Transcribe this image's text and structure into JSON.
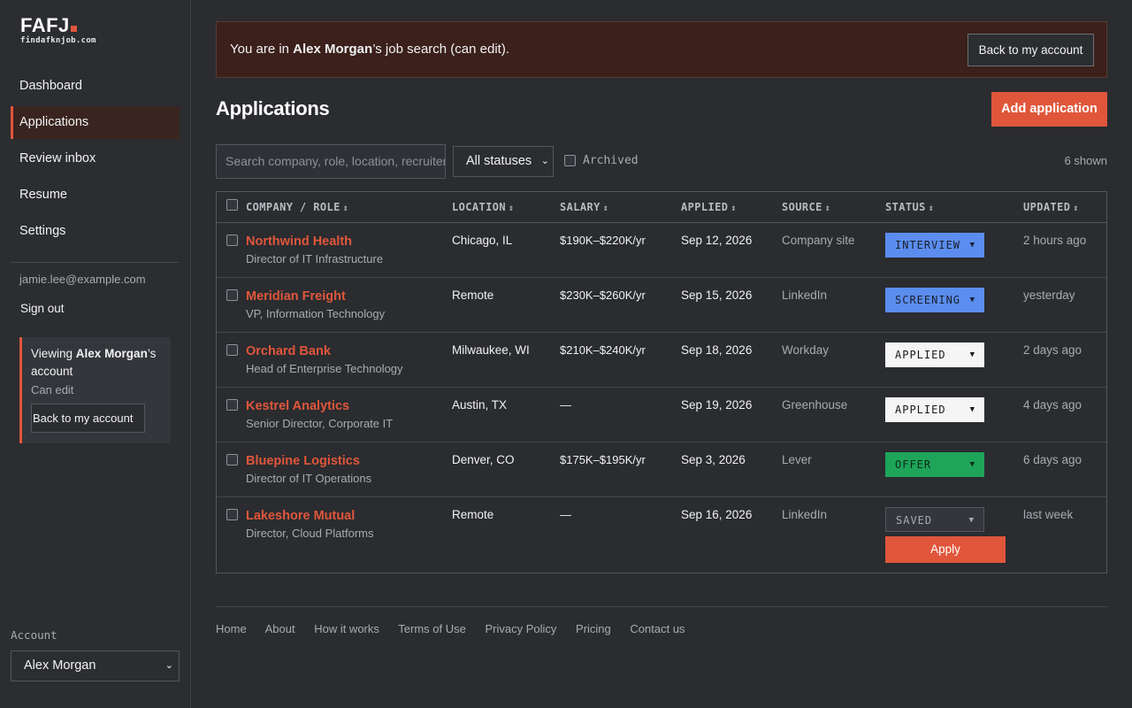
{
  "brand": {
    "name": "FAFJ",
    "domain": "findafknjob.com",
    "accent": "#e0563b"
  },
  "sidebar": {
    "items": [
      {
        "label": "Dashboard"
      },
      {
        "label": "Applications"
      },
      {
        "label": "Review inbox"
      },
      {
        "label": "Resume"
      },
      {
        "label": "Settings"
      }
    ],
    "email": "jamie.lee@example.com",
    "sign_out": "Sign out",
    "viewing": {
      "prefix": "Viewing ",
      "name": "Alex Morgan",
      "suffix": "’s account",
      "permission": "Can edit",
      "back_label": "Back to my account"
    },
    "account_label": "Account",
    "account_value": "Alex Morgan"
  },
  "banner": {
    "prefix": "You are in ",
    "name": "Alex Morgan",
    "suffix": "’s job search (can edit).",
    "button": "Back to my account"
  },
  "page": {
    "title": "Applications",
    "add_button": "Add application"
  },
  "filters": {
    "search_placeholder": "Search company, role, location, recruiter",
    "status_value": "All statuses",
    "archived_label": "Archived",
    "shown": "6 shown"
  },
  "table": {
    "columns": [
      "COMPANY / ROLE",
      "LOCATION",
      "SALARY",
      "APPLIED",
      "SOURCE",
      "STATUS",
      "UPDATED"
    ],
    "rows": [
      {
        "company": "Northwind Health",
        "role": "Director of IT Infrastructure",
        "location": "Chicago, IL",
        "salary": "$190K–$220K/yr",
        "applied": "Sep 12, 2026",
        "source": "Company site",
        "status": "INTERVIEW",
        "updated": "2 hours ago"
      },
      {
        "company": "Meridian Freight",
        "role": "VP, Information Technology",
        "location": "Remote",
        "salary": "$230K–$260K/yr",
        "applied": "Sep 15, 2026",
        "source": "LinkedIn",
        "status": "SCREENING",
        "updated": "yesterday"
      },
      {
        "company": "Orchard Bank",
        "role": "Head of Enterprise Technology",
        "location": "Milwaukee, WI",
        "salary": "$210K–$240K/yr",
        "applied": "Sep 18, 2026",
        "source": "Workday",
        "status": "APPLIED",
        "updated": "2 days ago"
      },
      {
        "company": "Kestrel Analytics",
        "role": "Senior Director, Corporate IT",
        "location": "Austin, TX",
        "salary": "—",
        "applied": "Sep 19, 2026",
        "source": "Greenhouse",
        "status": "APPLIED",
        "updated": "4 days ago"
      },
      {
        "company": "Bluepine Logistics",
        "role": "Director of IT Operations",
        "location": "Denver, CO",
        "salary": "$175K–$195K/yr",
        "applied": "Sep 3, 2026",
        "source": "Lever",
        "status": "OFFER",
        "updated": "6 days ago"
      },
      {
        "company": "Lakeshore Mutual",
        "role": "Director, Cloud Platforms",
        "location": "Remote",
        "salary": "—",
        "applied": "Sep 16, 2026",
        "source": "LinkedIn",
        "status": "SAVED",
        "updated": "last week",
        "action": "Apply"
      }
    ]
  },
  "footer": {
    "links": [
      "Home",
      "About",
      "How it works",
      "Terms of Use",
      "Privacy Policy",
      "Pricing",
      "Contact us"
    ]
  }
}
